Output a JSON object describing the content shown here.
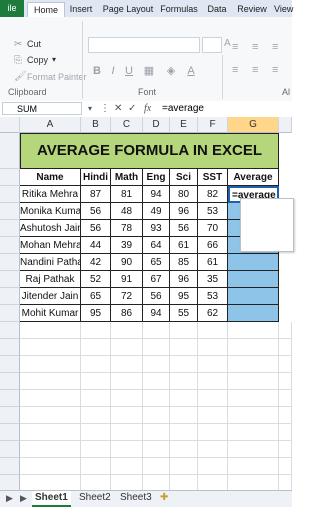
{
  "ribbon_tabs": [
    "ile",
    "Home",
    "Insert",
    "Page Layout",
    "Formulas",
    "Data",
    "Review",
    "View"
  ],
  "clipboard": {
    "cut": "Cut",
    "copy": "Copy",
    "format_painter": "Format Painter",
    "label": "Clipboard"
  },
  "font": {
    "label": "Font",
    "bold": "B",
    "italic": "I",
    "underline": "U",
    "fontcolor": "A"
  },
  "alignment": {
    "label": "Al"
  },
  "formula_bar": {
    "name_box": "SUM",
    "cancel": "✕",
    "enter": "✓",
    "fx": "fx",
    "formula": "=average"
  },
  "columns": [
    "A",
    "B",
    "C",
    "D",
    "E",
    "F",
    "G"
  ],
  "title": "AVERAGE FORMULA IN EXCEL",
  "headers": [
    "Name",
    "Hindi",
    "Math",
    "Eng",
    "Sci",
    "SST",
    "Average"
  ],
  "rows": [
    {
      "name": "Ritika Mehra",
      "hindi": "87",
      "math": "81",
      "eng": "94",
      "sci": "80",
      "sst": "82",
      "average": "=average"
    },
    {
      "name": "Monika Kumari",
      "hindi": "56",
      "math": "48",
      "eng": "49",
      "sci": "96",
      "sst": "53",
      "average": ""
    },
    {
      "name": "Ashutosh Jain",
      "hindi": "56",
      "math": "78",
      "eng": "93",
      "sci": "56",
      "sst": "70",
      "average": ""
    },
    {
      "name": "Mohan Mehra",
      "hindi": "44",
      "math": "39",
      "eng": "64",
      "sci": "61",
      "sst": "66",
      "average": ""
    },
    {
      "name": "Nandini Pathak",
      "hindi": "42",
      "math": "90",
      "eng": "65",
      "sci": "85",
      "sst": "61",
      "average": ""
    },
    {
      "name": "Raj Pathak",
      "hindi": "52",
      "math": "91",
      "eng": "67",
      "sci": "96",
      "sst": "35",
      "average": ""
    },
    {
      "name": "Jitender Jain",
      "hindi": "65",
      "math": "72",
      "eng": "56",
      "sci": "95",
      "sst": "53",
      "average": ""
    },
    {
      "name": "Mohit Kumar",
      "hindi": "95",
      "math": "86",
      "eng": "94",
      "sci": "55",
      "sst": "62",
      "average": ""
    }
  ],
  "sheets": [
    "Sheet1",
    "Sheet2",
    "Sheet3"
  ],
  "active_sheet": "Sheet1",
  "colors": {
    "accent_green": "#1e7b3c",
    "title_fill": "#b5d67b",
    "avg_fill": "#8ec4e8",
    "active_border": "#1f5fb0"
  }
}
